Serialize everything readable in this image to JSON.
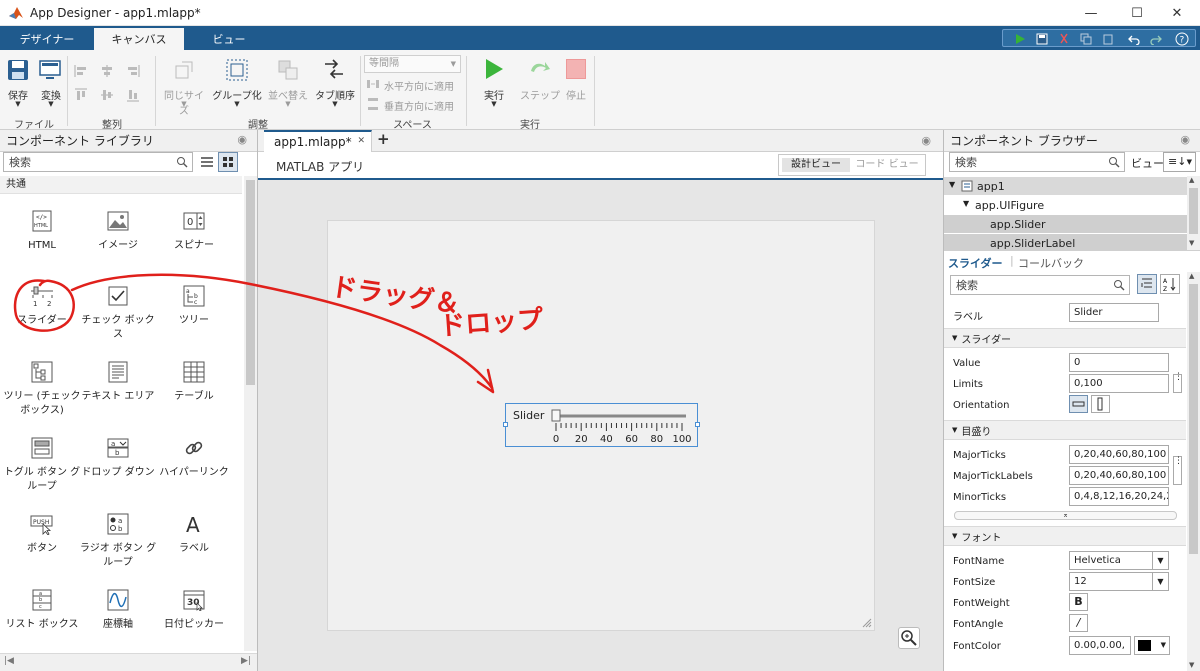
{
  "window": {
    "title": "App Designer - app1.mlapp*",
    "minimize": "—",
    "maximize": "☐",
    "close": "✕"
  },
  "ribbon_tabs": [
    "デザイナー",
    "キャンバス",
    "ビュー"
  ],
  "ribbon": {
    "save": "保存",
    "convert": "変換",
    "file_group": "ファイル",
    "align_group": "整列",
    "same_size": "同じサイズ",
    "group": "グループ化",
    "reorder": "並べ替え",
    "tab_order": "タブ順序",
    "arrange_group": "調整",
    "spacing_select": "等間隔",
    "apply_horizontal": "水平方向に適用",
    "apply_vertical": "垂直方向に適用",
    "space_group": "スペース",
    "run": "実行",
    "step": "ステップ",
    "stop": "停止",
    "run_group": "実行"
  },
  "library": {
    "title": "コンポーネント ライブラリ",
    "search_placeholder": "検索",
    "category": "共通",
    "items": [
      {
        "label": "HTML",
        "icon": "html-icon"
      },
      {
        "label": "イメージ",
        "icon": "image-icon"
      },
      {
        "label": "スピナー",
        "icon": "spinner-icon"
      },
      {
        "label": "スライダー",
        "icon": "slider-icon"
      },
      {
        "label": "チェック ボックス",
        "icon": "checkbox-icon"
      },
      {
        "label": "ツリー",
        "icon": "tree-icon"
      },
      {
        "label": "ツリー (チェック\nボックス)",
        "icon": "checkbox-tree-icon"
      },
      {
        "label": "テキスト エリア",
        "icon": "text-area-icon"
      },
      {
        "label": "テーブル",
        "icon": "table-icon"
      },
      {
        "label": "トグル ボタン グ\nループ",
        "icon": "toggle-button-group-icon"
      },
      {
        "label": "ドロップ ダウン",
        "icon": "dropdown-icon"
      },
      {
        "label": "ハイパーリンク",
        "icon": "hyperlink-icon"
      },
      {
        "label": "ボタン",
        "icon": "button-icon"
      },
      {
        "label": "ラジオ ボタン グ\nループ",
        "icon": "radio-button-group-icon"
      },
      {
        "label": "ラベル",
        "icon": "label-icon"
      },
      {
        "label": "リスト ボックス",
        "icon": "list-box-icon"
      },
      {
        "label": "座標軸",
        "icon": "axes-icon"
      },
      {
        "label": "日付ピッカー",
        "icon": "date-picker-icon"
      }
    ],
    "icon_text": {
      "html": "HTML",
      "push": "PUSH",
      "calendar": "30",
      "a_glyph": "A",
      "table_nums": "1|2|3"
    }
  },
  "canvas": {
    "doc_tab": "app1.mlapp*",
    "add_tab": "+",
    "app_title": "MATLAB アプリ",
    "design_view": "設計ビュー",
    "code_view": "コード ビュー",
    "slider_label": "Slider",
    "ticks": [
      "0",
      "20",
      "40",
      "60",
      "80",
      "100"
    ],
    "annotation_drag": "ドラッグ＆",
    "annotation_drop": "ドロップ"
  },
  "browser": {
    "title": "コンポーネント ブラウザー",
    "search_placeholder": "検索",
    "view_label": "ビュー:",
    "tree": [
      "app1",
      "app.UIFigure",
      "app.Slider",
      "app.SliderLabel"
    ]
  },
  "inspector": {
    "tab_slider": "スライダー",
    "tab_callback": "コールバック",
    "search_placeholder": "検索",
    "label_key": "ラベル",
    "label_value": "Slider",
    "sections": {
      "slider": "スライダー",
      "ticks": "目盛り",
      "font": "フォント"
    },
    "props": {
      "value_key": "Value",
      "value": "0",
      "limits_key": "Limits",
      "limits": "0,100",
      "orientation_key": "Orientation",
      "major_ticks_key": "MajorTicks",
      "major_ticks": "0,20,40,60,80,100",
      "major_tick_labels_key": "MajorTickLabels",
      "major_tick_labels": "0,20,40,60,80,100",
      "minor_ticks_key": "MinorTicks",
      "minor_ticks": "0,4,8,12,16,20,24,2",
      "fontname_key": "FontName",
      "fontname": "Helvetica",
      "fontsize_key": "FontSize",
      "fontsize": "12",
      "fontweight_key": "FontWeight",
      "fontweight_glyph": "B",
      "fontangle_key": "FontAngle",
      "fontangle_glyph": "/",
      "fontcolor_key": "FontColor",
      "fontcolor": "0.00,0.00,"
    }
  },
  "colors": {
    "accent": "#1f5a8d",
    "annotation": "#e0201b",
    "selection": "#cfcfcf"
  }
}
